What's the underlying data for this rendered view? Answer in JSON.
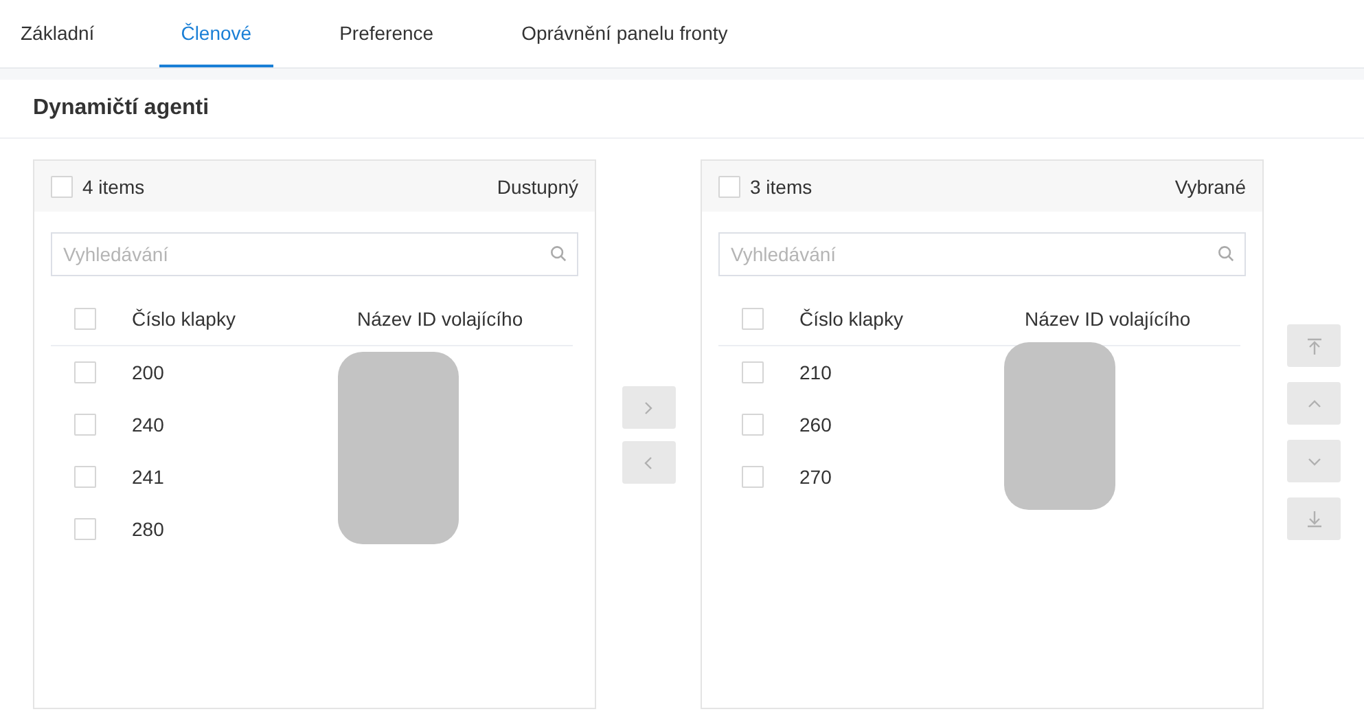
{
  "tabs": [
    {
      "label": "Základní",
      "selected": false
    },
    {
      "label": "Členové",
      "selected": true
    },
    {
      "label": "Preference",
      "selected": false
    },
    {
      "label": "Oprávnění panelu fronty",
      "selected": false
    }
  ],
  "section_title": "Dynamičtí agenti",
  "panels": [
    {
      "count": "4 items",
      "title": "Dustupný",
      "checked": false,
      "search": {
        "placeholder": "Vyhledávání"
      },
      "columns": [
        "Číslo klapky",
        "Název ID volajícího"
      ],
      "header_checked": false,
      "rows": [
        {
          "extension": "200",
          "checked": false
        },
        {
          "extension": "240",
          "checked": false
        },
        {
          "extension": "241",
          "checked": false
        },
        {
          "extension": "280",
          "checked": false
        }
      ]
    },
    {
      "count": "3 items",
      "title": "Vybrané",
      "checked": false,
      "search": {
        "placeholder": "Vyhledávání"
      },
      "columns": [
        "Číslo klapky",
        "Název ID volajícího"
      ],
      "header_checked": false,
      "rows": [
        {
          "extension": "210",
          "checked": false
        },
        {
          "extension": "260",
          "checked": false
        },
        {
          "extension": "270",
          "checked": false
        }
      ]
    }
  ],
  "transfer_buttons": [
    {
      "kind": "right",
      "disabled": true
    },
    {
      "kind": "left",
      "disabled": true
    }
  ],
  "order_buttons": [
    {
      "kind": "top",
      "disabled": true
    },
    {
      "kind": "up",
      "disabled": true
    },
    {
      "kind": "down",
      "disabled": true
    },
    {
      "kind": "bottom",
      "disabled": true
    }
  ]
}
